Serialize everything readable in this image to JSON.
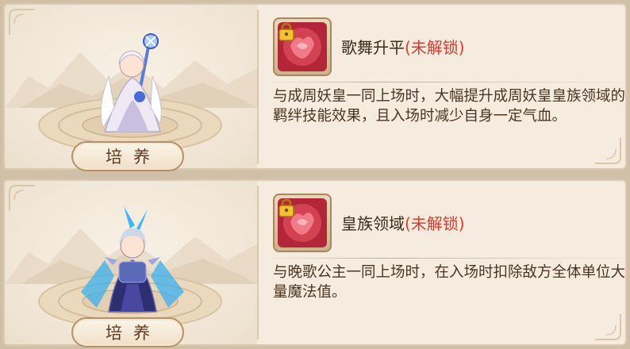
{
  "cards": [
    {
      "button_label": "培养",
      "skill": {
        "name": "歌舞升平",
        "status": "(未解锁)",
        "description": "与成周妖皇一同上场时，大幅提升成周妖皇皇族领域的羁绊技能效果，且入场时减少自身一定气血。"
      },
      "hero_colors": {
        "primary": "#f0ecf5",
        "accent": "#4a6ad8"
      }
    },
    {
      "button_label": "培养",
      "skill": {
        "name": "皇族领域",
        "status": "(未解锁)",
        "description": "与晚歌公主一同上场时，在入场时扣除敌方全体单位大量魔法值。"
      },
      "hero_colors": {
        "primary": "#2a2a6a",
        "accent": "#38a8f0"
      }
    }
  ],
  "colors": {
    "locked_status": "#e03a2c",
    "card_bg": "#f5ecdf",
    "page_bg": "#cfc0a7"
  }
}
